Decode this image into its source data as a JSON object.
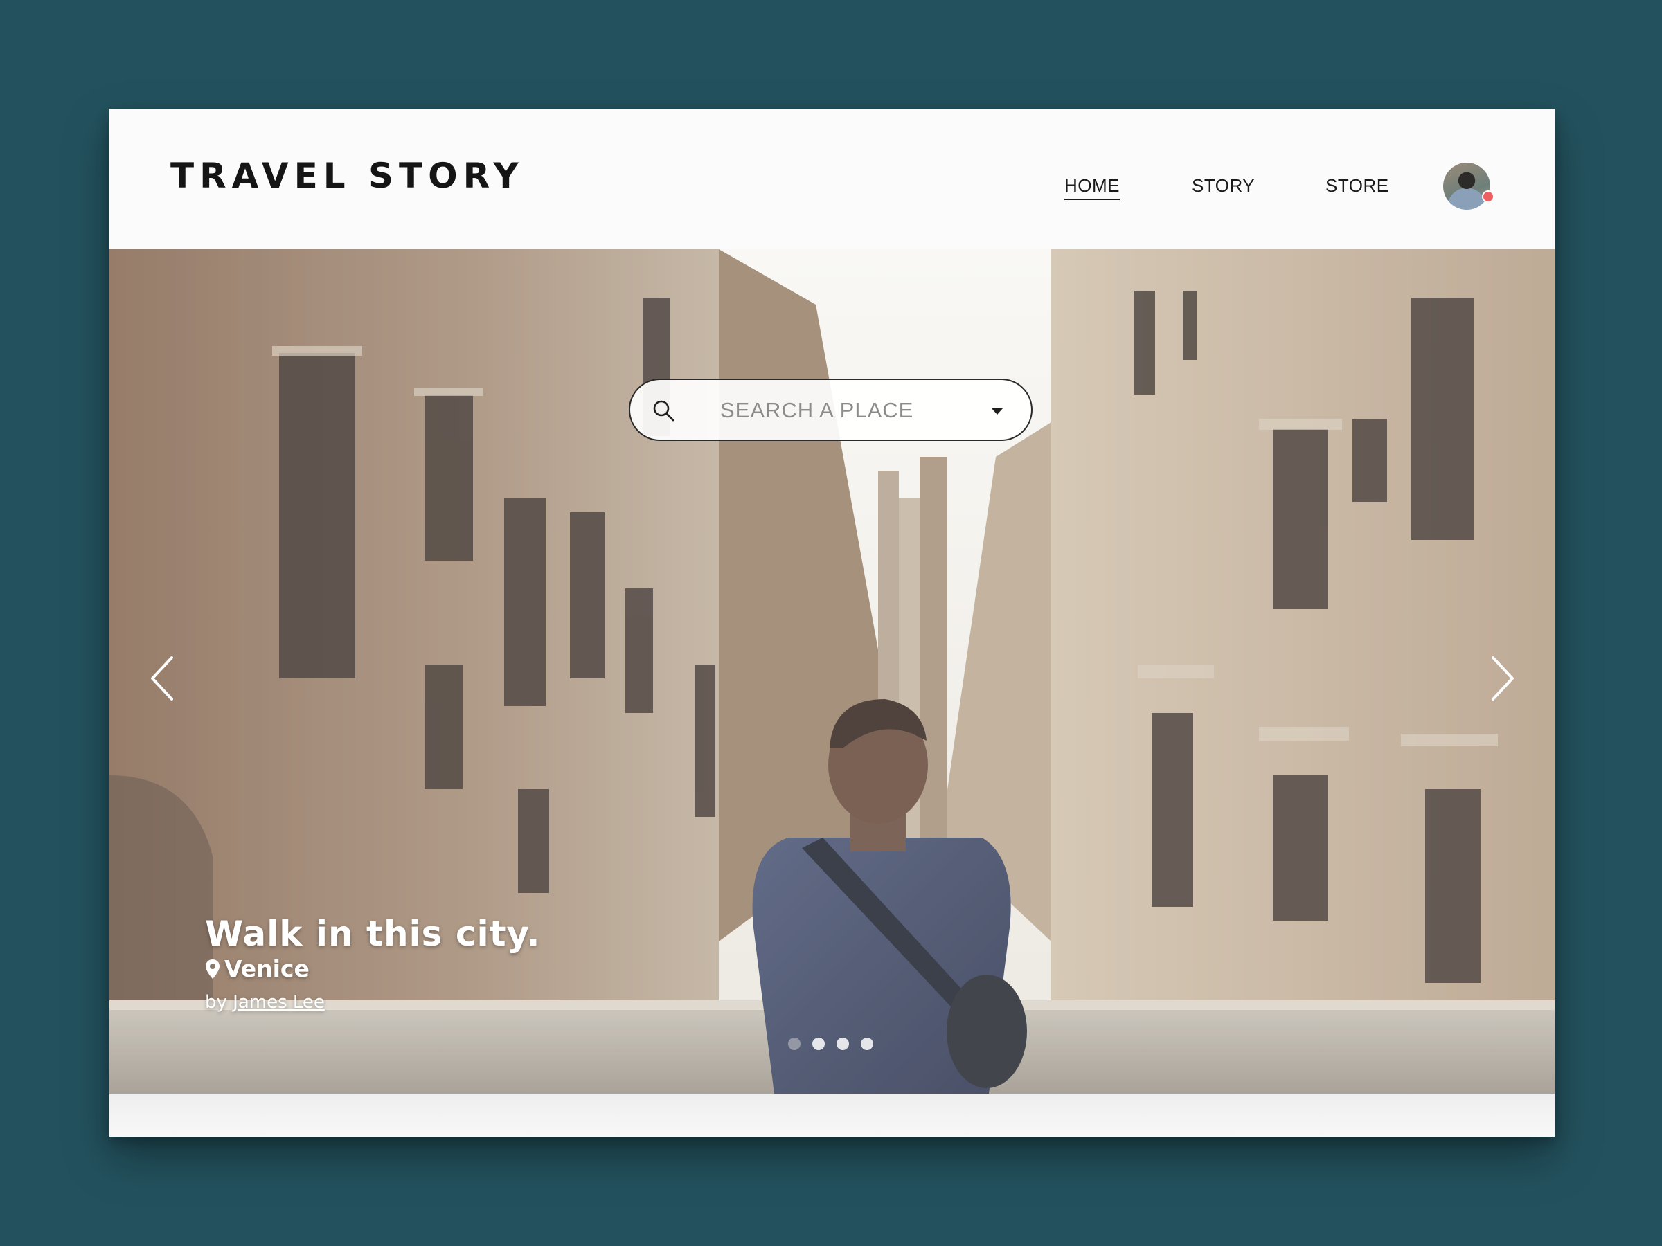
{
  "brand": {
    "name": "TRAVEL STORY"
  },
  "nav": {
    "items": [
      {
        "label": "HOME",
        "active": true
      },
      {
        "label": "STORY",
        "active": false
      },
      {
        "label": "STORE",
        "active": false
      }
    ]
  },
  "user": {
    "avatar_icon": "user-avatar",
    "notification_color": "#ef5f5f"
  },
  "search": {
    "placeholder": "SEARCH A PLACE",
    "value": ""
  },
  "hero": {
    "title": "Walk in this city.",
    "location": "Venice",
    "author_prefix": "by",
    "author_name": "James Lee",
    "slides_count": 4,
    "active_slide": 1
  },
  "colors": {
    "background": "#23525e",
    "accent": "#1a1a1a"
  }
}
